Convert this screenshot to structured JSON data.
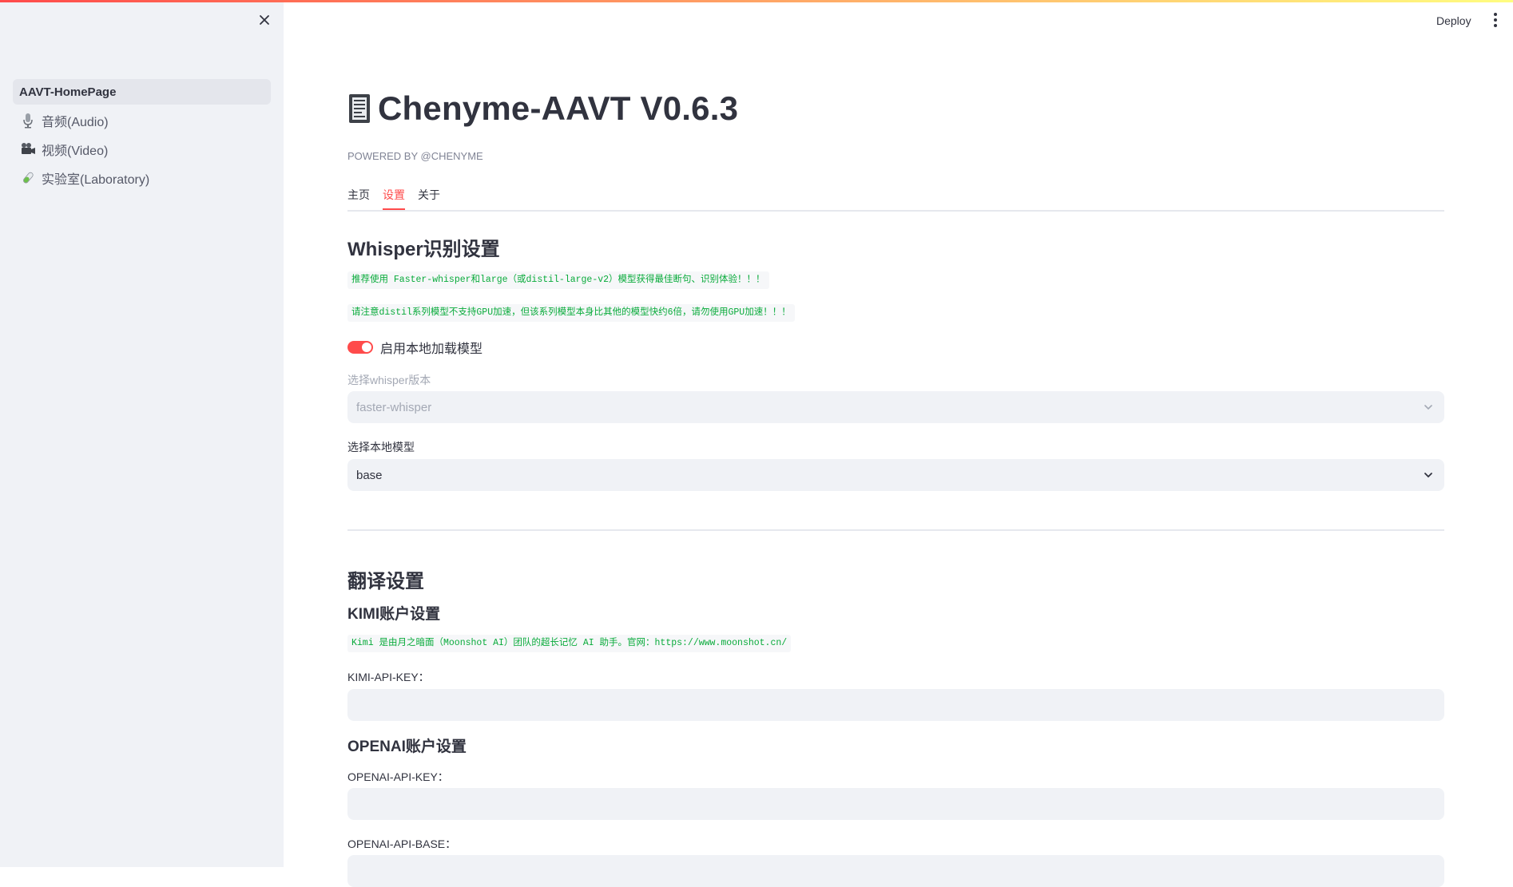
{
  "header": {
    "deploy_label": "Deploy",
    "menu_icon": "more-vertical-icon"
  },
  "colors": {
    "accent": "#ff4b4b",
    "code_text": "#09ab3b",
    "sidebar_bg": "#f0f2f6"
  },
  "sidebar": {
    "close_icon": "close-icon",
    "items": [
      {
        "label": "AAVT-HomePage",
        "icon": "",
        "active": true
      },
      {
        "label": "音频(Audio)",
        "icon": "microphone-icon",
        "active": false
      },
      {
        "label": "视频(Video)",
        "icon": "video-camera-icon",
        "active": false
      },
      {
        "label": "实验室(Laboratory)",
        "icon": "test-tube-icon",
        "active": false
      }
    ]
  },
  "main": {
    "title_icon": "document-icon",
    "title": "Chenyme-AAVT V0.6.3",
    "caption": "POWERED BY @CHENYME",
    "tabs": [
      {
        "label": "主页",
        "active": false
      },
      {
        "label": "设置",
        "active": true
      },
      {
        "label": "关于",
        "active": false
      }
    ],
    "whisper": {
      "heading": "Whisper识别设置",
      "note1": "推荐使用 Faster-whisper和large（或distil-large-v2）模型获得最佳断句、识别体验！！！",
      "note2": "请注意distil系列模型不支持GPU加速，但该系列模型本身比其他的模型快约6倍，请勿使用GPU加速！！！",
      "toggle_label": "启用本地加载模型",
      "toggle_on": true,
      "version_label": "选择whisper版本",
      "version_value": "faster-whisper",
      "model_label": "选择本地模型",
      "model_value": "base"
    },
    "translation": {
      "heading": "翻译设置",
      "kimi_heading": "KIMI账户设置",
      "kimi_note": "Kimi 是由月之暗面（Moonshot AI）团队的超长记忆 AI 助手。官网：https://www.moonshot.cn/",
      "kimi_key_label": "KIMI-API-KEY：",
      "kimi_key_value": "",
      "openai_heading": "OPENAI账户设置",
      "openai_key_label": "OPENAI-API-KEY：",
      "openai_key_value": "",
      "openai_base_label": "OPENAI-API-BASE：",
      "openai_base_value": ""
    }
  }
}
